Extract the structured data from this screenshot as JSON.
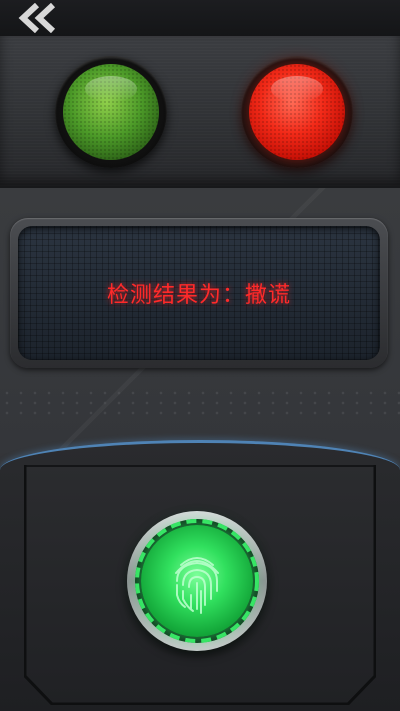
{
  "header": {
    "back_icon": "double-chevron-left-icon"
  },
  "indicators": {
    "green_lamp": {
      "state": "off",
      "color": "#4c9a28"
    },
    "red_lamp": {
      "state": "on",
      "color": "#f22a18"
    }
  },
  "result": {
    "text": "检测结果为：撒谎",
    "text_color": "#ff2a2a"
  },
  "scanner": {
    "icon": "fingerprint-icon",
    "accent_color": "#31e05e",
    "edge_color": "#4f83b5"
  }
}
